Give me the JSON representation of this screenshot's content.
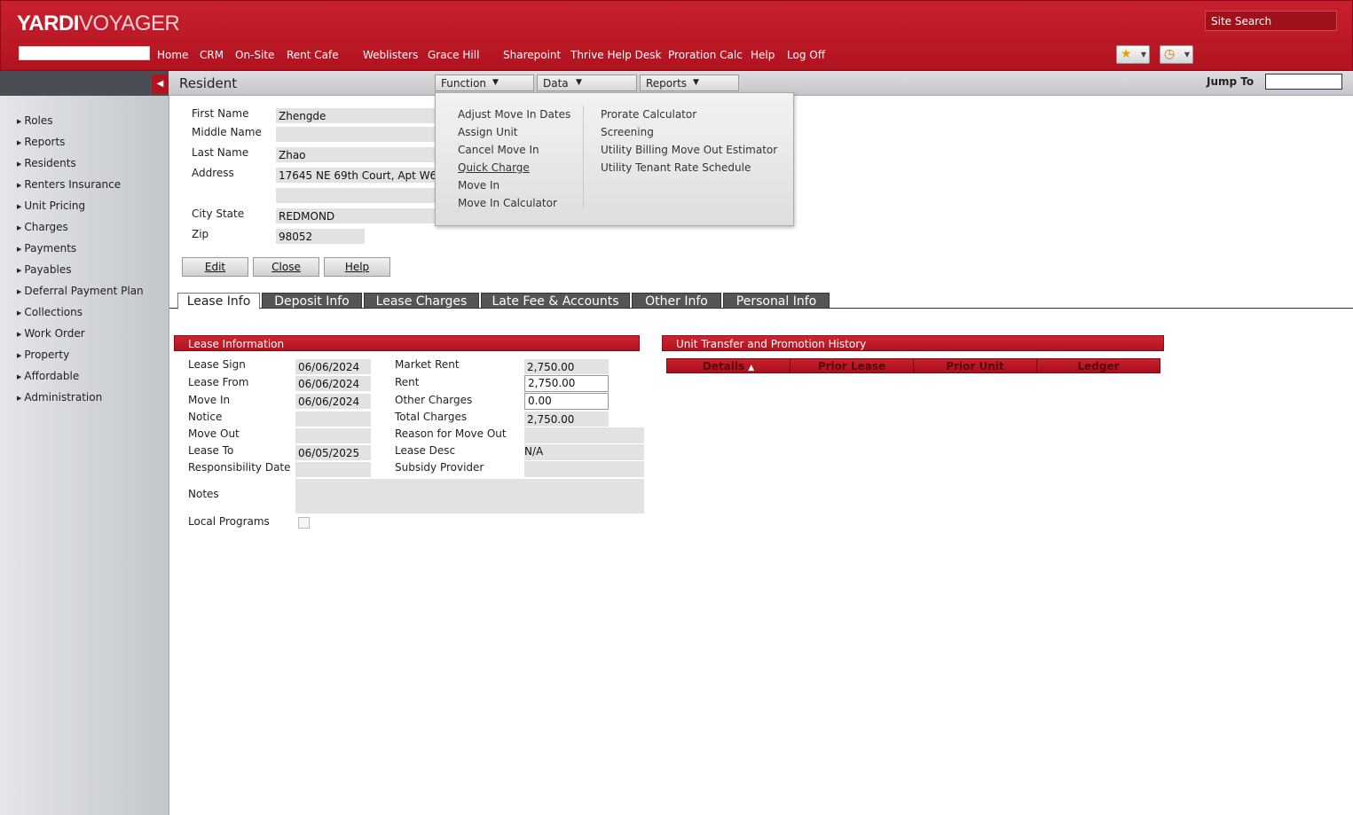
{
  "app": {
    "logo_bold": "YARDI",
    "logo_light": "VOYAGER",
    "site_search_placeholder": "Site Search"
  },
  "nav": [
    "Home",
    "CRM",
    "On-Site",
    "Rent Cafe",
    "Weblisters",
    "Grace Hill",
    "Sharepoint",
    "Thrive Help Desk",
    "Proration Calc",
    "Help",
    "Log Off"
  ],
  "icons": {
    "favorites": "star-icon",
    "history": "clock-icon"
  },
  "subbar": {
    "title": "Resident",
    "menus": [
      "Function",
      "Data",
      "Reports"
    ],
    "jump_to_label": "Jump To"
  },
  "sidebar": [
    "Roles",
    "Reports",
    "Residents",
    "Renters Insurance",
    "Unit Pricing",
    "Charges",
    "Payments",
    "Payables",
    "Deferral Payment Plan",
    "Collections",
    "Work Order",
    "Property",
    "Affordable",
    "Administration"
  ],
  "resident": {
    "first_name_label": "First Name",
    "first_name": "Zhengde",
    "middle_name_label": "Middle Name",
    "middle_name": "",
    "last_name_label": "Last Name",
    "last_name": "Zhao",
    "address_label": "Address",
    "address1": "17645 NE 69th Court, Apt W649",
    "address2": "",
    "city_state_label": "City State",
    "city_state": "REDMOND",
    "zip_label": "Zip",
    "zip": "98052"
  },
  "buttons": [
    "Edit",
    "Close",
    "Help"
  ],
  "tabs": [
    "Lease Info",
    "Deposit Info",
    "Lease Charges",
    "Late Fee & Accounts",
    "Other Info",
    "Personal Info"
  ],
  "lease": {
    "section_title": "Lease Information",
    "lease_sign_label": "Lease Sign",
    "lease_sign": "06/06/2024",
    "lease_from_label": "Lease From",
    "lease_from": "06/06/2024",
    "move_in_label": "Move In",
    "move_in": "06/06/2024",
    "notice_label": "Notice",
    "notice": "",
    "move_out_label": "Move Out",
    "move_out": "",
    "lease_to_label": "Lease To",
    "lease_to": "06/05/2025",
    "resp_date_label": "Responsibility Date",
    "resp_date": "",
    "notes_label": "Notes",
    "local_programs_label": "Local Programs",
    "market_rent_label": "Market Rent",
    "market_rent": "2,750.00",
    "rent_label": "Rent",
    "rent": "2,750.00",
    "other_charges_label": "Other Charges",
    "other_charges": "0.00",
    "total_charges_label": "Total Charges",
    "total_charges": "2,750.00",
    "reason_label": "Reason for Move Out",
    "reason": "",
    "lease_desc_label": "Lease Desc",
    "lease_desc": "N/A",
    "subsidy_label": "Subsidy Provider",
    "subsidy": ""
  },
  "transfer": {
    "section_title": "Unit Transfer and Promotion History",
    "columns": [
      "Details",
      "Prior Lease",
      "Prior Unit",
      "Ledger"
    ],
    "sort_glyph": "▲"
  },
  "function_menu": {
    "col1": [
      "Adjust Move In Dates",
      "Assign Unit",
      "Cancel Move In",
      "Quick Charge",
      "Move In",
      "Move In Calculator"
    ],
    "col2": [
      "Prorate Calculator",
      "Screening",
      "Utility Billing Move Out Estimator",
      "Utility Tenant Rate Schedule"
    ]
  }
}
